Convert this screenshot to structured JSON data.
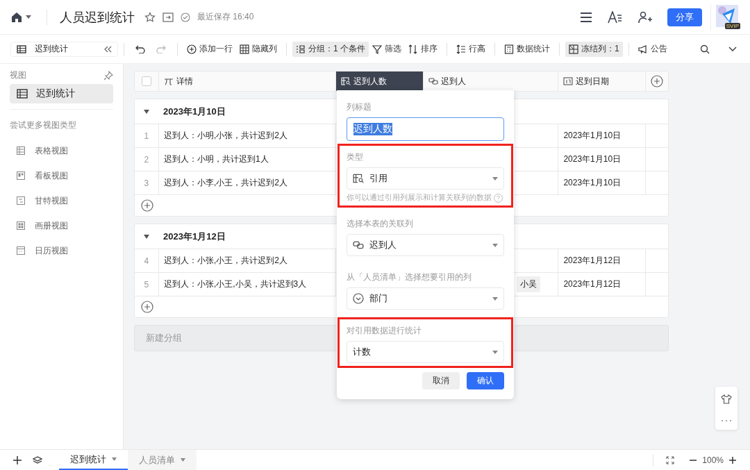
{
  "topbar": {
    "title": "人员迟到统计",
    "save_status": "最近保存 16:40",
    "share_button": "分享",
    "avatar_badge": "SVIP"
  },
  "toolbar": {
    "view": "迟到统计",
    "tools": [
      {
        "kind": "add",
        "label": "添加一行",
        "active": false
      },
      {
        "kind": "hide",
        "label": "隐藏列",
        "active": false
      },
      {
        "kind": "group",
        "label": "分组：1 个条件",
        "active": true
      },
      {
        "kind": "filter",
        "label": "筛选",
        "active": false
      },
      {
        "kind": "sort",
        "label": "排序",
        "active": false
      },
      {
        "kind": "height",
        "label": "行高",
        "active": false
      },
      {
        "kind": "stats",
        "label": "数据统计",
        "active": false
      },
      {
        "kind": "freeze",
        "label": "冻结列：1",
        "active": true
      },
      {
        "kind": "notice",
        "label": "公告",
        "active": false
      }
    ]
  },
  "sidebar": {
    "heading": "视图",
    "views": [
      {
        "label": "迟到统计",
        "selected": true
      }
    ],
    "more_heading": "尝试更多视图类型",
    "view_types": [
      {
        "kind": "grid",
        "label": "表格视图"
      },
      {
        "kind": "kanban",
        "label": "看板视图"
      },
      {
        "kind": "gantt",
        "label": "甘特视图"
      },
      {
        "kind": "gallery",
        "label": "画册视图"
      },
      {
        "kind": "calendar",
        "label": "日历视图"
      }
    ]
  },
  "table": {
    "header_checkbox": {
      "checked": false
    },
    "columns": [
      {
        "kind": "formula",
        "label": "详情",
        "selected": false
      },
      {
        "kind": "lookup",
        "label": "迟到人数",
        "selected": true
      },
      {
        "kind": "link",
        "label": "迟到人",
        "selected": false
      },
      {
        "kind": "date",
        "label": "迟到日期",
        "selected": false
      }
    ],
    "groups": [
      {
        "title": "2023年1月10日",
        "expanded": true,
        "rows": [
          {
            "number": "1",
            "detail": "迟到人：小明,小张，共计迟到2人",
            "people": [],
            "date": "2023年1月10日"
          },
          {
            "number": "2",
            "detail": "迟到人：小明，共计迟到1人",
            "people": [],
            "date": "2023年1月10日"
          },
          {
            "number": "3",
            "detail": "迟到人：小李,小王，共计迟到2人",
            "people": [],
            "date": "2023年1月10日"
          }
        ]
      },
      {
        "title": "2023年1月12日",
        "expanded": true,
        "rows": [
          {
            "number": "4",
            "detail": "迟到人：小张,小王，共计迟到2人",
            "people": [],
            "date": "2023年1月12日"
          },
          {
            "number": "5",
            "detail": "迟到人：小张,小王,小吴，共计迟到3人",
            "people": [
              "小吴"
            ],
            "date": "2023年1月12日"
          }
        ]
      }
    ],
    "new_group": "新建分组"
  },
  "column_editor": {
    "title_label": "列标题",
    "title_value": "迟到人数",
    "sections": [
      {
        "label": "类型",
        "kind": "lookup",
        "value": "引用",
        "help": "你可以通过引用列展示和计算关联列的数据",
        "highlighted": true
      },
      {
        "label": "选择本表的关联列",
        "kind": "link",
        "value": "迟到人",
        "highlighted": false
      },
      {
        "label": "从「人员清单」选择想要引用的列",
        "kind": "option",
        "value": "部门",
        "highlighted": false
      },
      {
        "label": "对引用数据进行统计",
        "kind": "plain",
        "value": "计数",
        "highlighted": true
      }
    ],
    "cancel": "取消",
    "confirm": "确认"
  },
  "sheet_tabs": [
    {
      "label": "迟到统计",
      "selected": true
    },
    {
      "label": "人员清单",
      "selected": false
    }
  ],
  "zoom": "100%"
}
